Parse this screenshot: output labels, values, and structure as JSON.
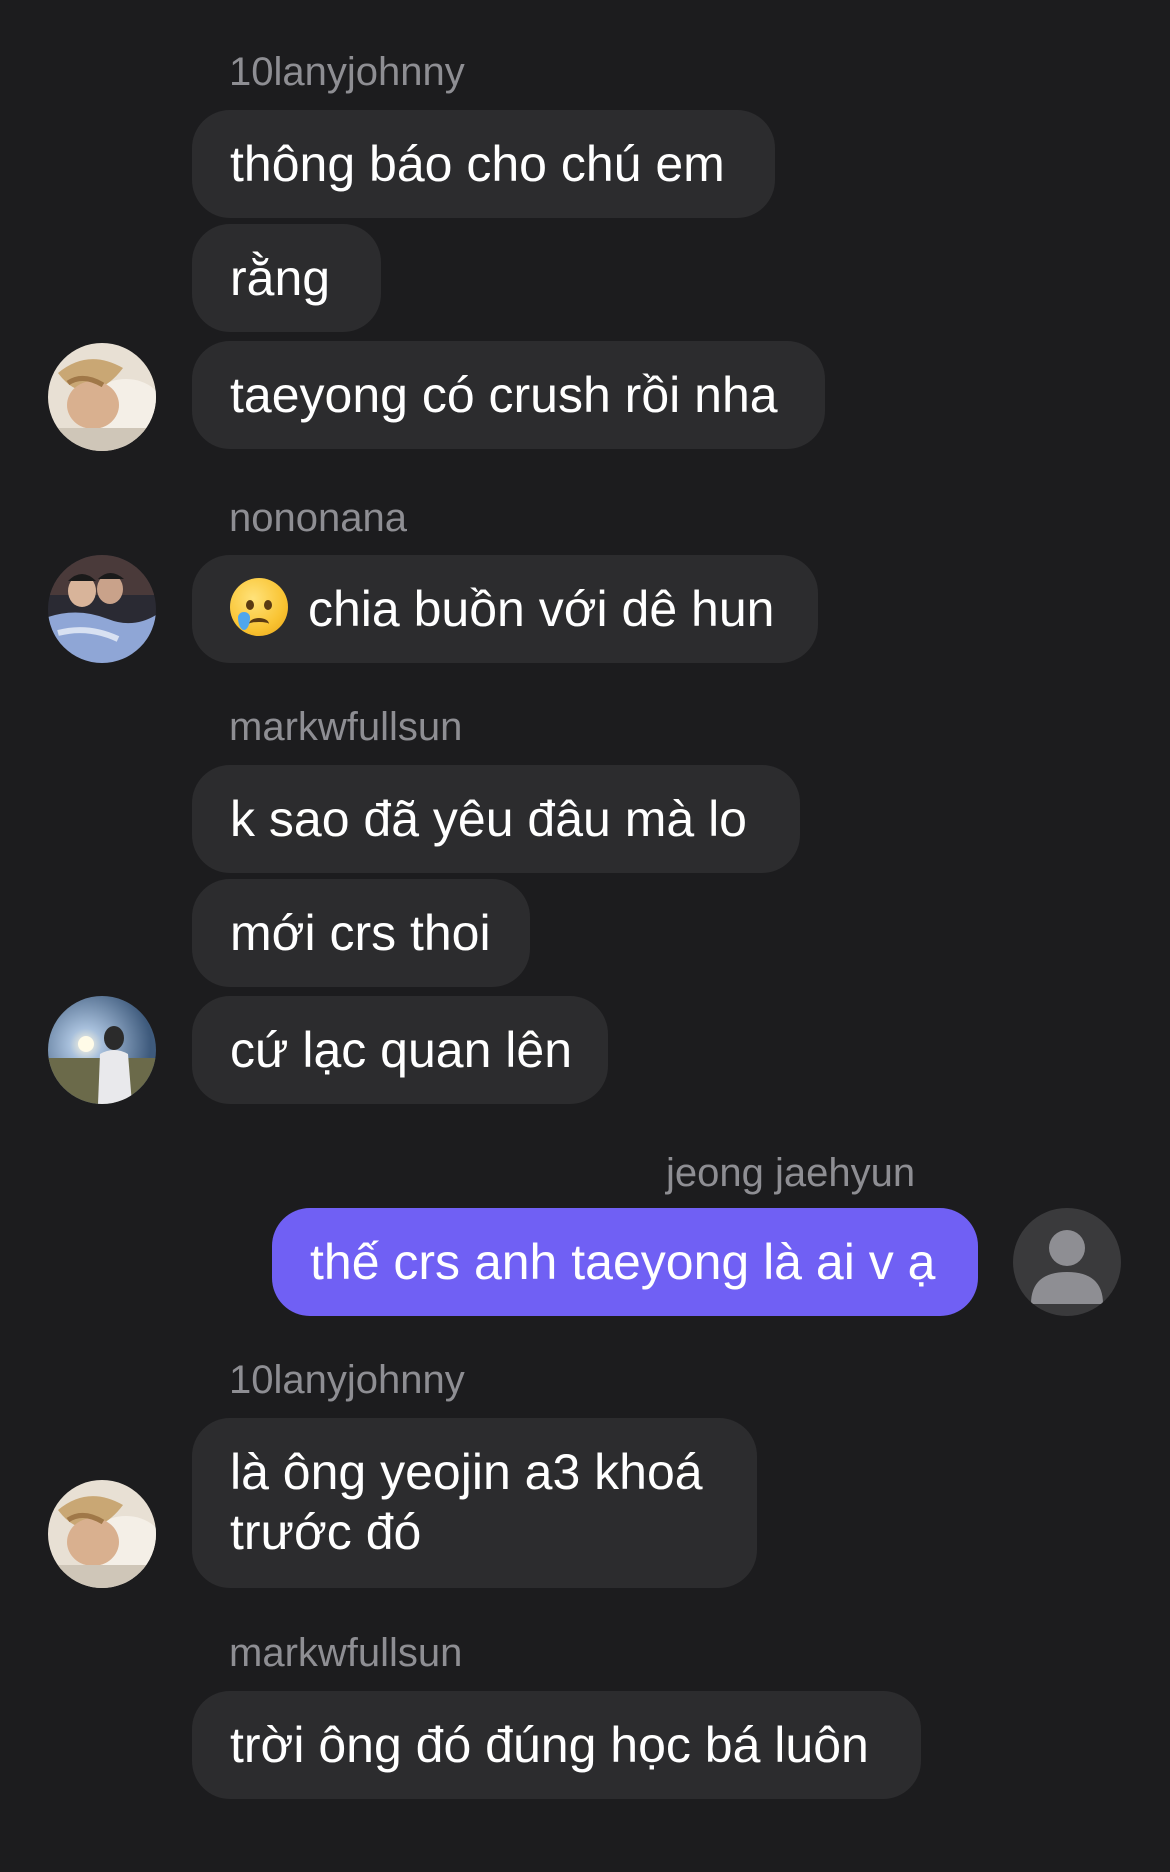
{
  "messages": [
    {
      "sender": "10lanyjohnny",
      "bubbles": [
        "thông báo cho chú em",
        "rằng",
        "taeyong có crush rồi nha"
      ]
    },
    {
      "sender": "nononana",
      "bubbles": [
        "chia buồn với dê hun"
      ],
      "emoji": "crying-face-icon"
    },
    {
      "sender": "markwfullsun",
      "bubbles": [
        "k sao đã yêu đâu mà lo",
        "mới crs thoi",
        "cứ lạc quan lên"
      ]
    },
    {
      "sender": "jeong jaehyun",
      "bubbles": [
        "thế crs anh taeyong là ai v ạ"
      ]
    },
    {
      "sender": "10lanyjohnny",
      "bubbles": [
        "là ông yeojin a3 khoá trước đó"
      ]
    },
    {
      "sender": "markwfullsun",
      "bubbles": [
        "trời ông đó đúng học bá luôn"
      ]
    }
  ],
  "colors": {
    "background": "#1c1c1e",
    "incoming_bubble": "#2c2c2e",
    "outgoing_bubble": "#7060f4",
    "sender_text": "#8e8e93"
  }
}
